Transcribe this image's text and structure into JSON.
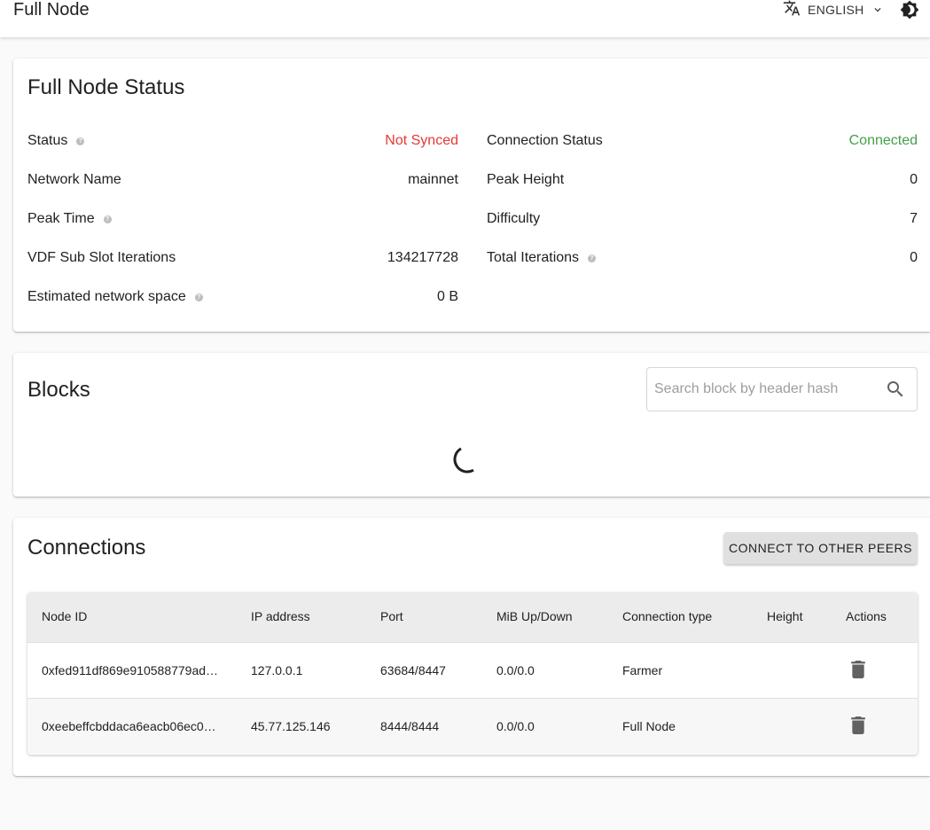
{
  "app": {
    "title": "Full Node",
    "language": "ENGLISH",
    "icons": {
      "translate": "translate-icon",
      "chevron": "chevron-down-icon",
      "theme": "theme-toggle-icon"
    }
  },
  "status_card": {
    "title": "Full Node Status",
    "left": [
      {
        "label": "Status",
        "value": "Not Synced",
        "help": true
      },
      {
        "label": "Network Name",
        "value": "mainnet",
        "help": false
      },
      {
        "label": "Peak Time",
        "value": "",
        "help": true
      },
      {
        "label": "VDF Sub Slot Iterations",
        "value": "134217728",
        "help": false
      },
      {
        "label": "Estimated network space",
        "value": "0 B",
        "help": true
      }
    ],
    "right": [
      {
        "label": "Connection Status",
        "value": "Connected",
        "help": false
      },
      {
        "label": "Peak Height",
        "value": "0",
        "help": false
      },
      {
        "label": "Difficulty",
        "value": "7",
        "help": false
      },
      {
        "label": "Total Iterations",
        "value": "0",
        "help": true
      }
    ],
    "colors": {
      "not_synced": "#e53935",
      "connected": "#43a047"
    }
  },
  "blocks_card": {
    "title": "Blocks",
    "search_placeholder": "Search block by header hash"
  },
  "connections_card": {
    "title": "Connections",
    "connect_button": "CONNECT TO OTHER PEERS",
    "columns": [
      "Node ID",
      "IP address",
      "Port",
      "MiB Up/Down",
      "Connection type",
      "Height",
      "Actions"
    ],
    "rows": [
      {
        "node_id": "0xfed911df869e910588779ad…",
        "ip": "127.0.0.1",
        "port": "63684/8447",
        "mib": "0.0/0.0",
        "type": "Farmer",
        "height": ""
      },
      {
        "node_id": "0xeebeffcbddaca6eacb06ec0…",
        "ip": "45.77.125.146",
        "port": "8444/8444",
        "mib": "0.0/0.0",
        "type": "Full Node",
        "height": ""
      }
    ]
  }
}
